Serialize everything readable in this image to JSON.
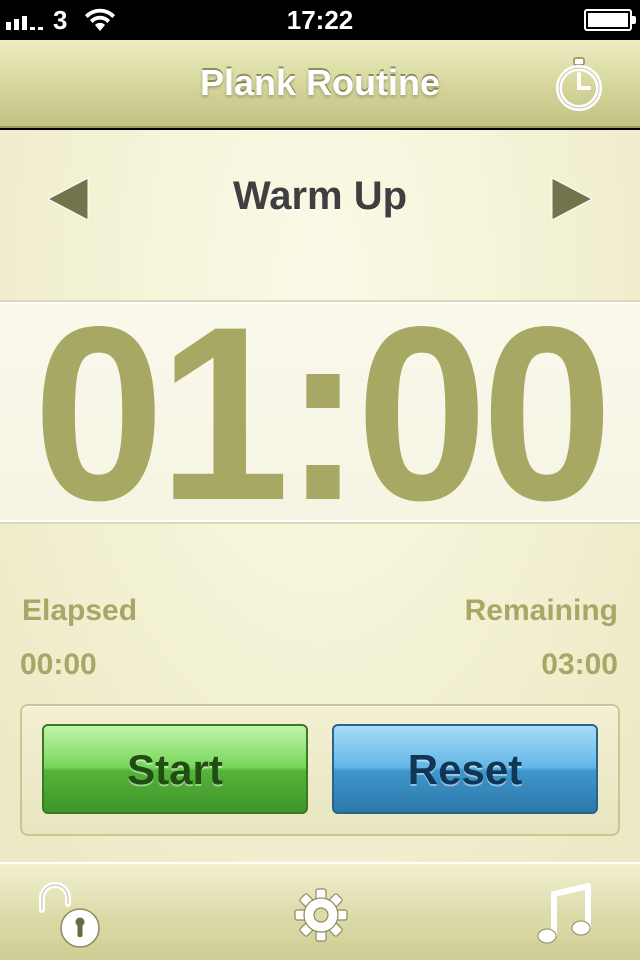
{
  "status_bar": {
    "carrier": "3",
    "time": "17:22"
  },
  "nav": {
    "title": "Plank Routine",
    "right_icon": "stopwatch-icon"
  },
  "routine": {
    "name": "Warm Up",
    "prev_icon": "triangle-left-icon",
    "next_icon": "triangle-right-icon"
  },
  "timer": {
    "display": "01:00"
  },
  "stats": {
    "elapsed_label": "Elapsed",
    "elapsed_value": "00:00",
    "remaining_label": "Remaining",
    "remaining_value": "03:00"
  },
  "actions": {
    "start_label": "Start",
    "reset_label": "Reset"
  },
  "tab_bar": {
    "icons": [
      "unlock-icon",
      "gear-icon",
      "music-note-icon"
    ]
  },
  "colors": {
    "accent_olive": "#a8a865",
    "nav_bar": "#d7d79e",
    "start_green": "#55b33a",
    "reset_blue": "#3f97cc",
    "background": "#f3f1d3"
  }
}
